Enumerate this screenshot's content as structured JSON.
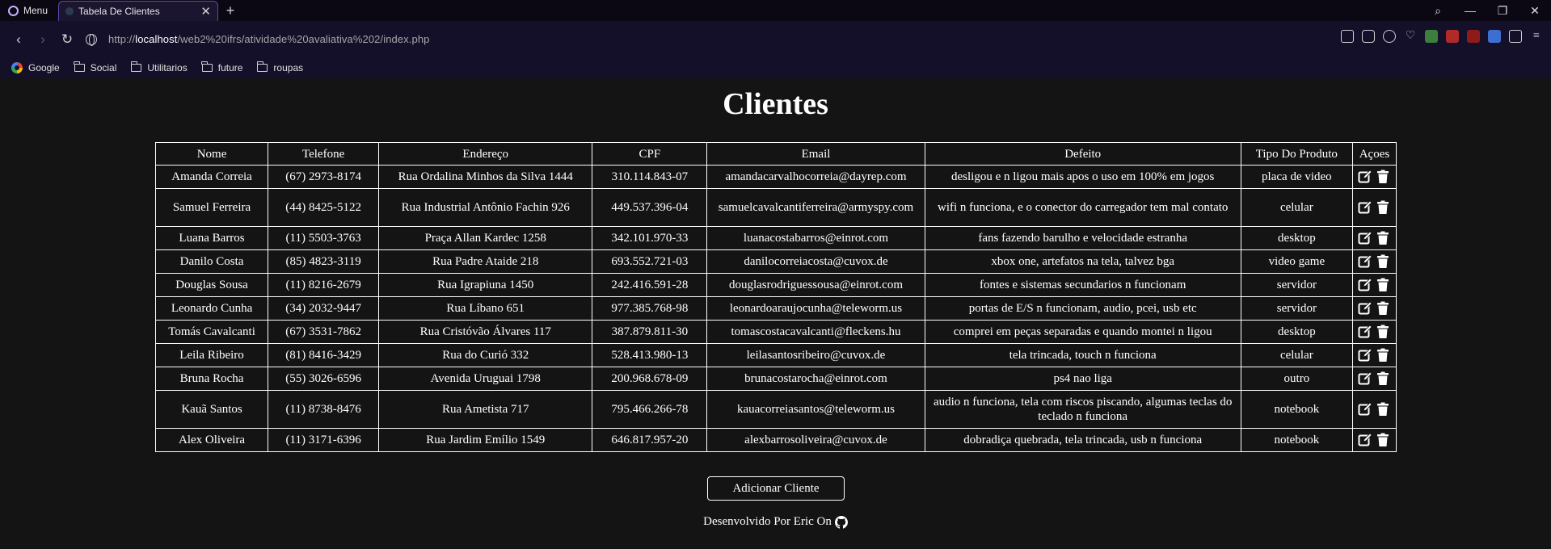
{
  "browser": {
    "menu_label": "Menu",
    "tab_title": "Tabela De Clientes",
    "url_prefix": "http://",
    "url_host": "localhost",
    "url_path": "/web2%20ifrs/atividade%20avaliativa%202/index.php",
    "bookmarks": [
      "Google",
      "Social",
      "Utilitarios",
      "future",
      "roupas"
    ]
  },
  "page": {
    "title": "Clientes",
    "add_button": "Adicionar Cliente",
    "footer_text": "Desenvolvido Por Eric On"
  },
  "table": {
    "headers": [
      "Nome",
      "Telefone",
      "Endereço",
      "CPF",
      "Email",
      "Defeito",
      "Tipo Do Produto",
      "Açoes"
    ],
    "rows": [
      {
        "nome": "Amanda Correia",
        "telefone": "(67) 2973-8174",
        "endereco": "Rua Ordalina Minhos da Silva 1444",
        "cpf": "310.114.843-07",
        "email": "amandacarvalhocorreia@dayrep.com",
        "defeito": "desligou e n ligou mais apos o uso em 100% em jogos",
        "tipo": "placa de video"
      },
      {
        "nome": "Samuel Ferreira",
        "telefone": "(44) 8425-5122",
        "endereco": "Rua Industrial Antônio Fachin 926",
        "cpf": "449.537.396-04",
        "email": "samuelcavalcantiferreira@armyspy.com",
        "defeito": "wifi n funciona, e o conector do carregador tem mal contato",
        "tipo": "celular"
      },
      {
        "nome": "Luana Barros",
        "telefone": "(11) 5503-3763",
        "endereco": "Praça Allan Kardec 1258",
        "cpf": "342.101.970-33",
        "email": "luanacostabarros@einrot.com",
        "defeito": "fans fazendo barulho e velocidade estranha",
        "tipo": "desktop"
      },
      {
        "nome": "Danilo Costa",
        "telefone": "(85) 4823-3119",
        "endereco": "Rua Padre Ataide 218",
        "cpf": "693.552.721-03",
        "email": "danilocorreiacosta@cuvox.de",
        "defeito": "xbox one, artefatos na tela, talvez bga",
        "tipo": "video game"
      },
      {
        "nome": "Douglas Sousa",
        "telefone": "(11) 8216-2679",
        "endereco": "Rua Igrapiuna 1450",
        "cpf": "242.416.591-28",
        "email": "douglasrodriguessousa@einrot.com",
        "defeito": "fontes e sistemas secundarios n funcionam",
        "tipo": "servidor"
      },
      {
        "nome": "Leonardo Cunha",
        "telefone": "(34) 2032-9447",
        "endereco": "Rua Líbano 651",
        "cpf": "977.385.768-98",
        "email": "leonardoaraujocunha@teleworm.us",
        "defeito": "portas de E/S n funcionam, audio, pcei, usb etc",
        "tipo": "servidor"
      },
      {
        "nome": "Tomás Cavalcanti",
        "telefone": "(67) 3531-7862",
        "endereco": "Rua Cristóvão Álvares 117",
        "cpf": "387.879.811-30",
        "email": "tomascostacavalcanti@fleckens.hu",
        "defeito": "comprei em peças separadas e quando montei n ligou",
        "tipo": "desktop"
      },
      {
        "nome": "Leila Ribeiro",
        "telefone": "(81) 8416-3429",
        "endereco": "Rua do Curió 332",
        "cpf": "528.413.980-13",
        "email": "leilasantosribeiro@cuvox.de",
        "defeito": "tela trincada, touch n funciona",
        "tipo": "celular"
      },
      {
        "nome": "Bruna Rocha",
        "telefone": "(55) 3026-6596",
        "endereco": "Avenida Uruguai 1798",
        "cpf": "200.968.678-09",
        "email": "brunacostarocha@einrot.com",
        "defeito": "ps4 nao liga",
        "tipo": "outro"
      },
      {
        "nome": "Kauã Santos",
        "telefone": "(11) 8738-8476",
        "endereco": "Rua Ametista 717",
        "cpf": "795.466.266-78",
        "email": "kauacorreiasantos@teleworm.us",
        "defeito": "audio n funciona, tela com riscos piscando, algumas teclas do teclado n funciona",
        "tipo": "notebook"
      },
      {
        "nome": "Alex Oliveira",
        "telefone": "(11) 3171-6396",
        "endereco": "Rua Jardim Emílio 1549",
        "cpf": "646.817.957-20",
        "email": "alexbarrosoliveira@cuvox.de",
        "defeito": "dobradiça quebrada, tela trincada, usb n funciona",
        "tipo": "notebook"
      }
    ]
  },
  "icons": {
    "edit": "edit-icon",
    "delete": "trash-icon",
    "footer": "github-icon"
  }
}
